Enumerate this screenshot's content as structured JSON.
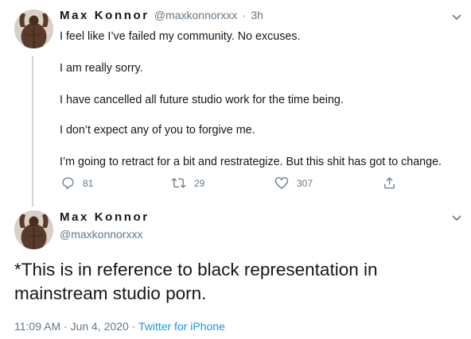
{
  "colors": {
    "text": "#14171a",
    "muted": "#657786",
    "link": "#1b95e0",
    "thread_line": "#ccd6dd"
  },
  "tweet1": {
    "name": "Max Konnor",
    "handle": "@maxkonnorxxx",
    "separator": "·",
    "time": "3h",
    "lines": [
      "I feel like I’ve failed my community.  No excuses.",
      "I am really sorry.",
      "I have cancelled all future studio work for the time being.",
      "I don’t expect any of you to forgive me.",
      "I’m going to retract for a bit and restrategize.  But this shit has got to change."
    ],
    "actions": {
      "reply_icon": "reply-icon",
      "replies": "81",
      "retweet_icon": "retweet-icon",
      "retweets": "29",
      "like_icon": "heart-icon",
      "likes": "307",
      "share_icon": "share-icon"
    }
  },
  "tweet2": {
    "name": "Max Konnor",
    "handle": "@maxkonnorxxx",
    "text": "*This is in reference to black representation in mainstream studio porn.",
    "timestamp": "11:09 AM · Jun 4, 2020",
    "meta_separator": "·",
    "source": "Twitter for iPhone"
  }
}
